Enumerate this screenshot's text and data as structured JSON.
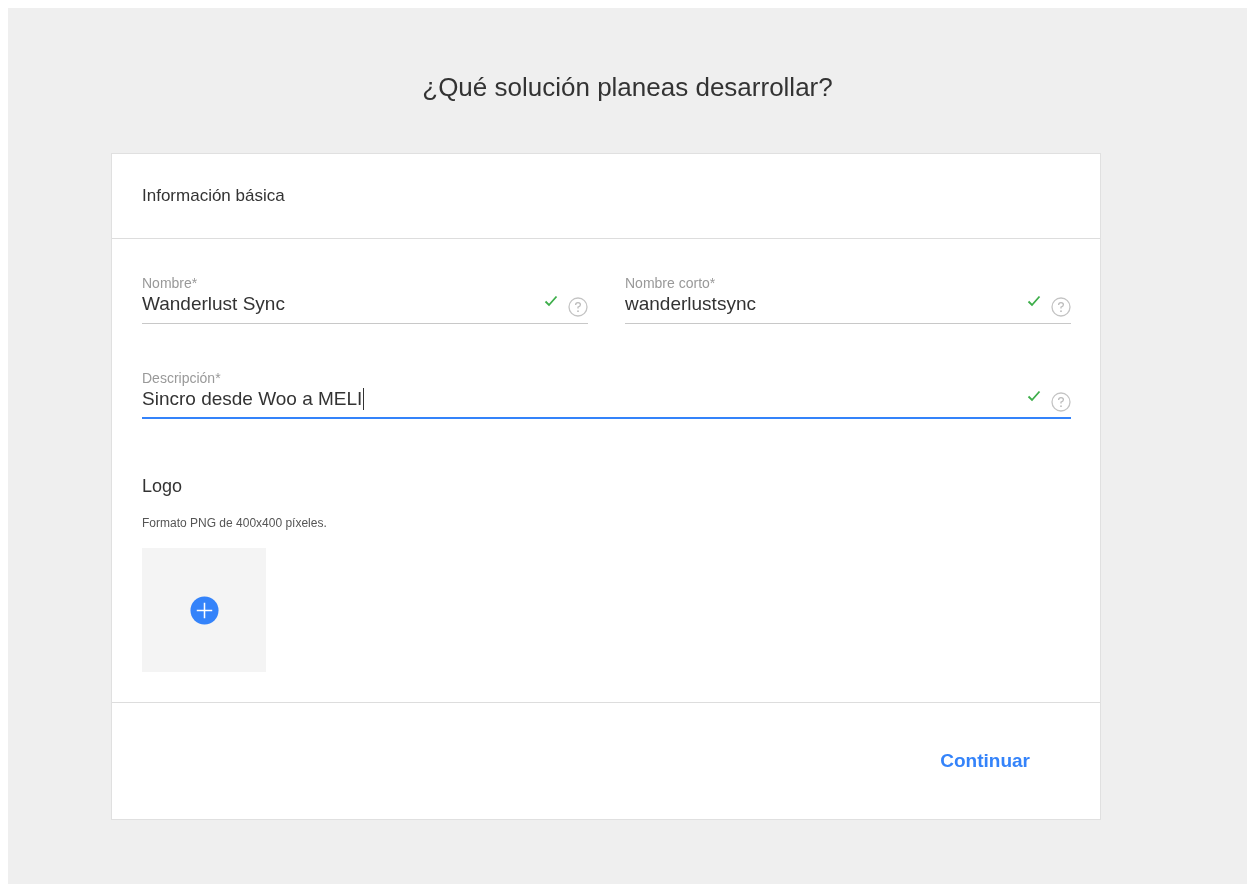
{
  "page_title": "¿Qué solución planeas desarrollar?",
  "card": {
    "section_title": "Información básica",
    "fields": [
      {
        "kind": "half",
        "label": "Nombre*",
        "value": "Wanderlust Sync",
        "valid": true,
        "focused": false
      },
      {
        "kind": "half",
        "label": "Nombre corto*",
        "value": "wanderlustsync",
        "valid": true,
        "focused": false
      },
      {
        "kind": "full",
        "label": "Descripción*",
        "value": "Sincro desde Woo a MELI",
        "valid": true,
        "focused": true
      }
    ],
    "logo": {
      "title": "Logo",
      "hint": "Formato PNG de 400x400 píxeles."
    },
    "footer": {
      "continue_button": "Continuar"
    }
  }
}
